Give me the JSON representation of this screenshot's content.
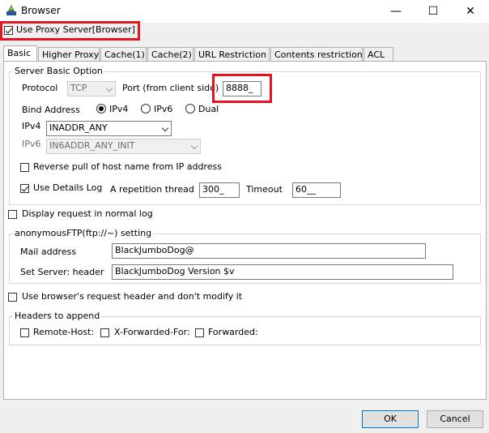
{
  "window": {
    "title": "Browser",
    "minimize_symbol": "—",
    "maximize_symbol": "☐",
    "close_symbol": "✕"
  },
  "use_proxy": {
    "label": "Use Proxy Server[Browser]",
    "checked": true
  },
  "tabs": [
    {
      "label": "Basic",
      "active": true
    },
    {
      "label": "Higher Proxy"
    },
    {
      "label": "Cache(1)"
    },
    {
      "label": "Cache(2)"
    },
    {
      "label": "URL Restriction"
    },
    {
      "label": "Contents restriction"
    },
    {
      "label": "ACL"
    }
  ],
  "server_basic": {
    "legend": "Server Basic Option",
    "protocol_label": "Protocol",
    "protocol_value": "TCP",
    "port_label": "Port (from client side)",
    "port_value": "8888_",
    "bind_label": "Bind Address",
    "bind_options": [
      "IPv4",
      "IPv6",
      "Dual"
    ],
    "bind_selected": "IPv4",
    "ipv4_label": "IPv4",
    "ipv4_value": "INADDR_ANY",
    "ipv6_label": "IPv6",
    "ipv6_value": "IN6ADDR_ANY_INIT",
    "reverse_pull_label": "Reverse pull of host name from IP address",
    "reverse_pull_checked": false,
    "details_log_label": "Use Details Log",
    "details_log_checked": true,
    "repetition_label": "A repetition thread",
    "repetition_value": "300_",
    "timeout_label": "Timeout",
    "timeout_value": "60__"
  },
  "display_normal_log": {
    "label": "Display request in normal log",
    "checked": false
  },
  "anon_ftp": {
    "legend": "anonymousFTP(ftp://~) setting",
    "mail_label": "Mail address",
    "mail_value": "BlackJumboDog@",
    "server_header_label": "Set Server: header",
    "server_header_value": "BlackJumboDog Version $v"
  },
  "browser_header": {
    "label": "Use browser's request header and don't modify it",
    "checked": false
  },
  "headers_append": {
    "legend": "Headers to append",
    "items": [
      {
        "label": "Remote-Host:",
        "checked": false
      },
      {
        "label": "X-Forwarded-For:",
        "checked": false
      },
      {
        "label": "Forwarded:",
        "checked": false
      }
    ]
  },
  "buttons": {
    "ok": "OK",
    "cancel": "Cancel"
  },
  "colors": {
    "highlight": "#e8131f",
    "panel_bg": "#ffffff",
    "window_bg": "#f0f0f0"
  }
}
